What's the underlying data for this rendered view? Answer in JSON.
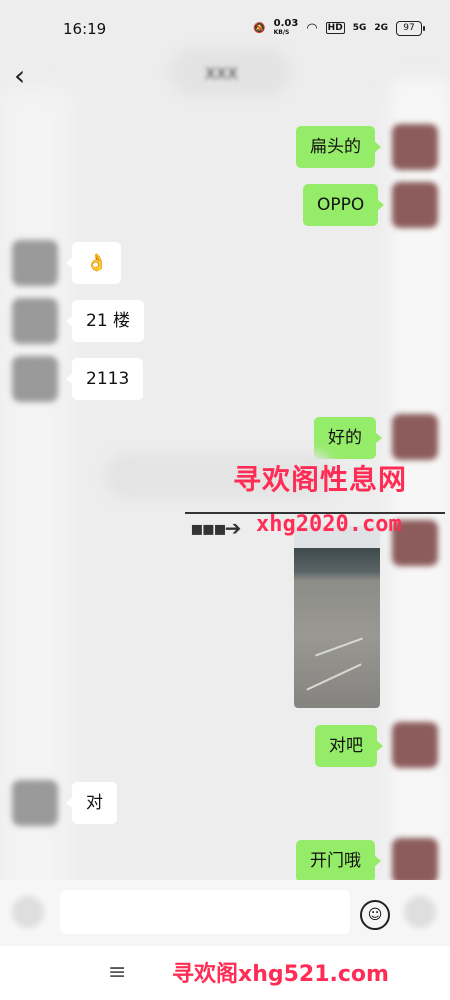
{
  "status_bar": {
    "time": "16:19",
    "network_speed": "0.03",
    "network_unit": "KB/S",
    "hd": "HD",
    "sig1": "5G",
    "sig2": "2G",
    "battery": "97"
  },
  "nav": {
    "back_icon": "back-arrow-icon",
    "title": "XXX"
  },
  "messages": [
    {
      "side": "sent",
      "text": "扁头的"
    },
    {
      "side": "sent",
      "text": "OPPO"
    },
    {
      "side": "recv",
      "text": "👌"
    },
    {
      "side": "recv",
      "text": "21 楼"
    },
    {
      "side": "recv",
      "text": "2113"
    },
    {
      "side": "sent",
      "text": "好的"
    },
    {
      "side": "sent",
      "text": "对吧"
    },
    {
      "side": "recv",
      "text": "对"
    },
    {
      "side": "sent",
      "text": "开门哦"
    }
  ],
  "watermark": {
    "top": "寻欢阁性息网",
    "url": "xhg2020.com",
    "bottom": "寻欢阁xhg521.com"
  },
  "input": {
    "emoji_icon": "smile-icon",
    "menu_icon": "menu-icon"
  },
  "colors": {
    "sent_bubble": "#95ec69",
    "recv_bubble": "#ffffff",
    "watermark": "#ff2d55"
  }
}
